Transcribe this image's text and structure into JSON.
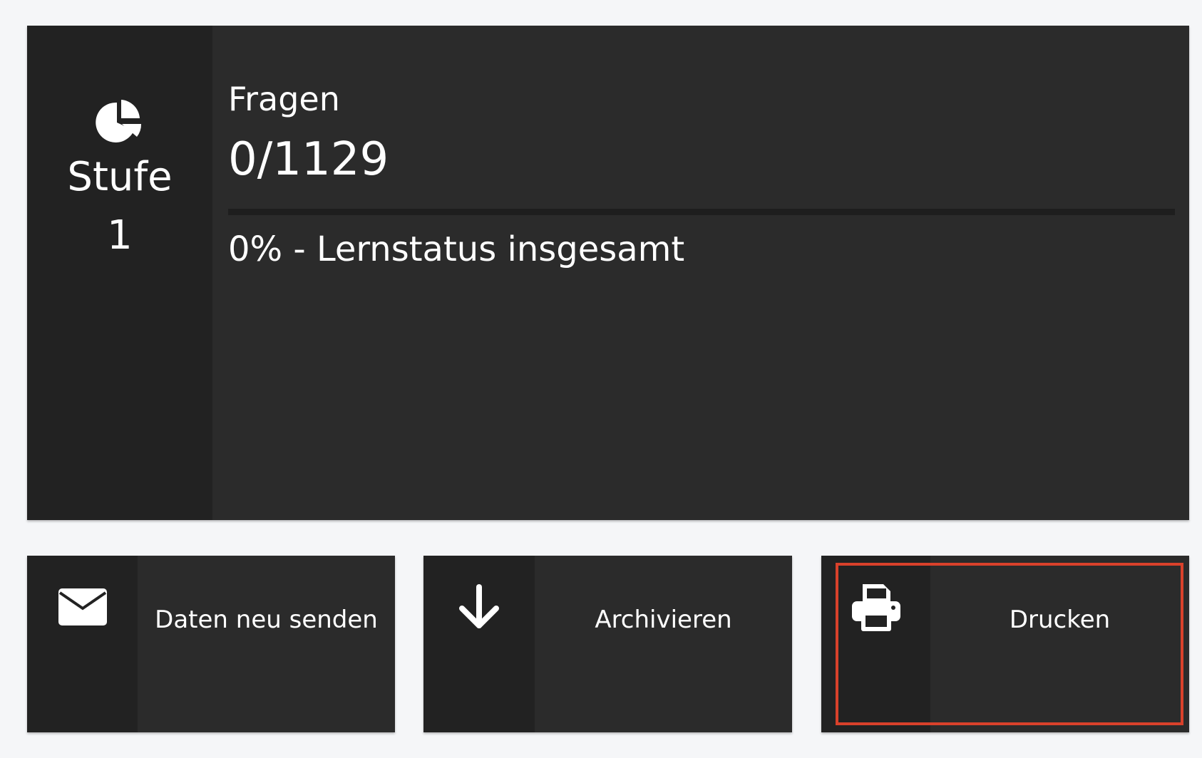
{
  "stats": {
    "icon": "pie-chart-icon",
    "stufe_label": "Stufe",
    "stufe_value": "1",
    "fragen_label": "Fragen",
    "fragen_value": "0/1129",
    "progress_percent": 0,
    "status_text": "0% - Lernstatus insgesamt"
  },
  "actions": {
    "send": {
      "label": "Daten neu senden",
      "icon": "envelope-icon"
    },
    "archive": {
      "label": "Archivieren",
      "icon": "arrow-down-icon"
    },
    "print": {
      "label": "Drucken",
      "icon": "printer-icon",
      "highlighted": true
    }
  },
  "colors": {
    "card_bg": "#2b2b2b",
    "icon_column_bg": "#222222",
    "page_bg": "#f5f6f8",
    "highlight": "#d9412b"
  }
}
